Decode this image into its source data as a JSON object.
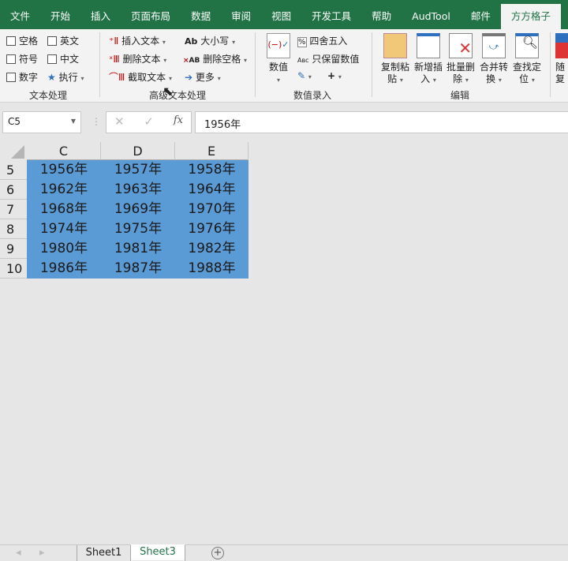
{
  "tabs": [
    "文件",
    "开始",
    "插入",
    "页面布局",
    "数据",
    "审阅",
    "视图",
    "开发工具",
    "帮助",
    "AudTool",
    "邮件",
    "方方格子"
  ],
  "active_tab": "方方格子",
  "ribbon": {
    "text_processing": {
      "checks": [
        "空格",
        "英文",
        "符号",
        "中文",
        "数字"
      ],
      "execute": "执行",
      "label": "文本处理"
    },
    "advanced_text": {
      "insert": "插入文本",
      "delete": "删除文本",
      "extract": "截取文本",
      "case": "大小写",
      "delete_spaces": "删除空格",
      "more": "更多",
      "label": "高级文本处理"
    },
    "numeric_entry": {
      "value": "数值",
      "round": "四舍五入",
      "keep_numbers": "只保留数值",
      "label": "数值录入"
    },
    "edit": {
      "copy_paste": [
        "复制粘",
        "贴"
      ],
      "insert_new": [
        "新增插",
        "入"
      ],
      "batch_delete": [
        "批量删",
        "除"
      ],
      "merge_convert": [
        "合并转",
        "换"
      ],
      "find_locate": [
        "查找定",
        "位"
      ],
      "random": [
        "随",
        "复"
      ],
      "label": "编辑"
    }
  },
  "formula_bar": {
    "name_box": "C5",
    "fx": "fx",
    "value": "1956年"
  },
  "columns": [
    "C",
    "D",
    "E"
  ],
  "rows": [
    {
      "n": "5",
      "cells": [
        "1956年",
        "1957年",
        "1958年"
      ]
    },
    {
      "n": "6",
      "cells": [
        "1962年",
        "1963年",
        "1964年"
      ]
    },
    {
      "n": "7",
      "cells": [
        "1968年",
        "1969年",
        "1970年"
      ]
    },
    {
      "n": "8",
      "cells": [
        "1974年",
        "1975年",
        "1976年"
      ]
    },
    {
      "n": "9",
      "cells": [
        "1980年",
        "1981年",
        "1982年"
      ]
    },
    {
      "n": "10",
      "cells": [
        "1986年",
        "1987年",
        "1988年"
      ]
    }
  ],
  "sheets": [
    "Sheet1",
    "Sheet3"
  ],
  "active_sheet": "Sheet3"
}
